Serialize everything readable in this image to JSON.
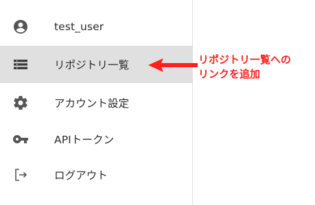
{
  "menu": {
    "items": [
      {
        "label": "test_user",
        "icon": "account-circle-icon"
      },
      {
        "label": "リポジトリ一覧",
        "icon": "list-icon",
        "active": true
      },
      {
        "label": "アカウント設定",
        "icon": "gear-icon"
      },
      {
        "label": "APIトークン",
        "icon": "key-icon"
      },
      {
        "label": "ログアウト",
        "icon": "logout-icon"
      }
    ]
  },
  "annotation": {
    "line1": "リポジトリ一覧への",
    "line2": "リンクを追加",
    "color": "#ff1f1f"
  },
  "colors": {
    "active_bg": "#e0e0e0",
    "icon": "#555555",
    "text": "#2b2b2b"
  }
}
